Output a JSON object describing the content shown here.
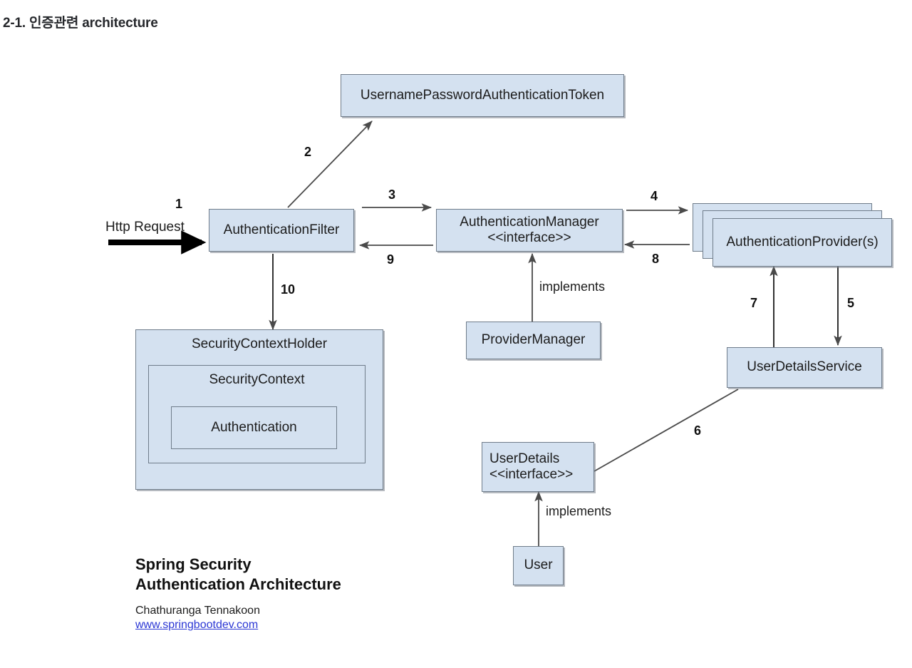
{
  "page": {
    "title": "2-1. 인증관련 architecture",
    "background": "#ffffff"
  },
  "theme": {
    "box_fill": "#d4e1f0",
    "box_border": "#6f7c8a",
    "line_color": "#4a4a4a",
    "thick_arrow_color": "#000000",
    "link_color": "#2b37d4",
    "text_color": "#1c1c1c"
  },
  "diagram": {
    "type": "architecture-flow",
    "name": "Spring Security Authentication Architecture",
    "nodes": {
      "token": {
        "label": "UsernamePasswordAuthenticationToken"
      },
      "filter": {
        "label": "AuthenticationFilter"
      },
      "manager": {
        "line1": "AuthenticationManager",
        "line2": "<<interface>>"
      },
      "provider": {
        "label": "AuthenticationProvider(s)"
      },
      "provider_manager": {
        "label": "ProviderManager"
      },
      "user_details_service": {
        "label": "UserDetailsService"
      },
      "security_context_holder": {
        "label": "SecurityContextHolder"
      },
      "security_context": {
        "label": "SecurityContext"
      },
      "authentication": {
        "label": "Authentication"
      },
      "user_details": {
        "line1": "UserDetails",
        "line2": "<<interface>>"
      },
      "user": {
        "label": "User"
      }
    },
    "edges": {
      "http_request": "Http Request",
      "implements_manager": "implements",
      "implements_user": "implements"
    },
    "steps": {
      "s1": "1",
      "s2": "2",
      "s3": "3",
      "s4": "4",
      "s5": "5",
      "s6": "6",
      "s7": "7",
      "s8": "8",
      "s9": "9",
      "s10": "10"
    }
  },
  "caption": {
    "title_line1": "Spring Security",
    "title_line2": "Authentication Architecture",
    "author": "Chathuranga Tennakoon",
    "website": "www.springbootdev.com"
  }
}
